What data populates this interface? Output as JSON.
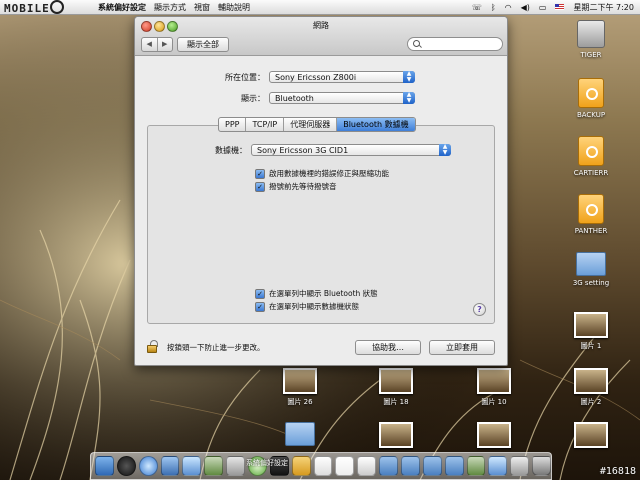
{
  "menubar": {
    "logo": "MOBILE",
    "app_name": "系統偏好設定",
    "menus": [
      "顯示方式",
      "視窗",
      "輔助說明"
    ],
    "clock": "星期二下午 7:20"
  },
  "window": {
    "title": "網路",
    "show_all": "顯示全部",
    "search_placeholder": "",
    "location_label": "所在位置：",
    "location_value": "Sony Ericsson Z800i",
    "show_label": "顯示：",
    "show_value": "Bluetooth",
    "tabs": [
      "PPP",
      "TCP/IP",
      "代理伺服器",
      "Bluetooth 數據機"
    ],
    "selected_tab": 3,
    "modem_label": "數據機：",
    "modem_value": "Sony Ericsson 3G CID1",
    "checks": [
      "啟用數據機裡的錯誤修正與壓縮功能",
      "撥號前先等待撥號音",
      "在選單列中顯示 Bluetooth 狀態",
      "在選單列中顯示數據機狀態"
    ],
    "lock_text": "按鎖頭一下防止進一步更改。",
    "assist_button": "協助我…",
    "apply_button": "立即套用",
    "help_glyph": "?"
  },
  "desktop_icons": [
    {
      "label": "TIGER",
      "kind": "disk"
    },
    {
      "label": "BACKUP",
      "kind": "firewire"
    },
    {
      "label": "CARTIERR",
      "kind": "firewire"
    },
    {
      "label": "PANTHER",
      "kind": "firewire"
    },
    {
      "label": "3G setting",
      "kind": "folder"
    },
    {
      "label": "圖片 1",
      "kind": "image"
    },
    {
      "label": "圖片 2",
      "kind": "image"
    },
    {
      "label": "圖片 26",
      "kind": "image"
    },
    {
      "label": "圖片 18",
      "kind": "image"
    },
    {
      "label": "圖片 10",
      "kind": "image"
    }
  ],
  "dock_tooltip": "系統偏好設定",
  "watermark": "#16818",
  "colors": {
    "accent": "#3f7fd8",
    "window_bg": "#ececec"
  }
}
